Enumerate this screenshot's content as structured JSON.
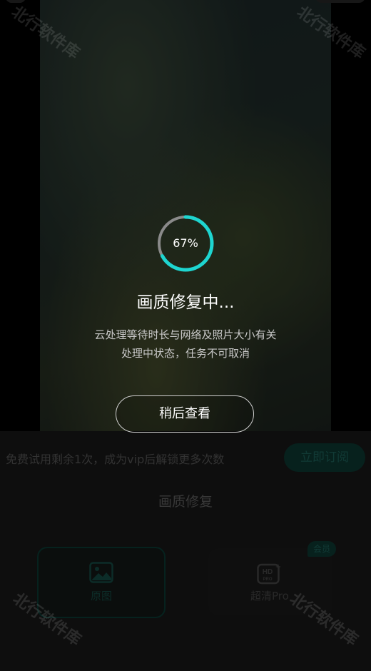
{
  "progress": {
    "percent": 0.67,
    "label": "67%"
  },
  "status": {
    "title": "画质修复中...",
    "line1": "云处理等待时长与网络及照片大小有关",
    "line2": "处理中状态，任务不可取消"
  },
  "later_button": "稍后查看",
  "sheet": {
    "trial_text": "免费试用剩余1次，成为vip后解锁更多次数",
    "subscribe_button": "立即订阅",
    "title": "画质修复",
    "options": [
      {
        "label": "原图",
        "icon": "image-icon",
        "selected": true
      },
      {
        "label": "超清Pro",
        "icon": "hd-pro-icon",
        "badge": "会员"
      }
    ]
  },
  "watermark": "北行软件库",
  "colors": {
    "accent": "#1ed5d0",
    "ring_track": "#8a8a8a",
    "sheet_bg": "#1a1a1a"
  }
}
